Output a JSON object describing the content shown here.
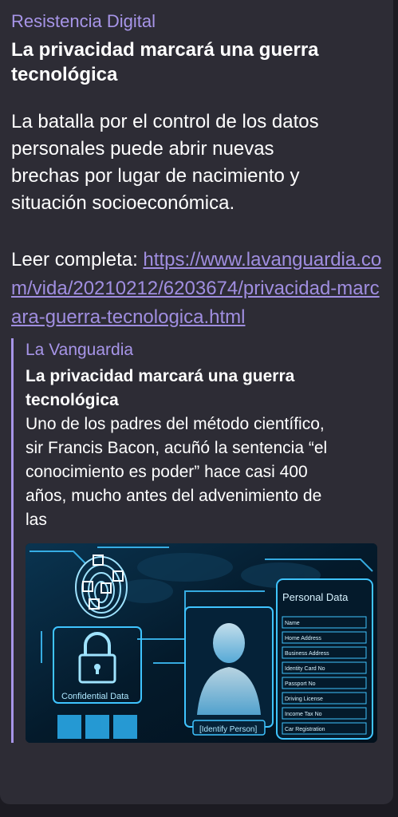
{
  "message": {
    "channel_name": "Resistencia Digital",
    "headline": "La privacidad marcará una guerra\ntecnológica",
    "body": "La batalla por el control de los datos\npersonales puede abrir nuevas\nbrechas por lugar de nacimiento y\nsituación socioeconómica.",
    "read_prefix": "Leer completa: ",
    "link_url": "https://www.lavanguardia.com/vida/20210212/6203674/privacidad-marcara-guerra-tecnologica.html"
  },
  "preview": {
    "site_name": "La Vanguardia",
    "title": "La privacidad marcará una guerra\ntecnológica",
    "description": "Uno de los padres del método científico,\nsir Francis Bacon, acuñó la sentencia “el\nconocimiento es poder” hace casi 400\naños, mucho antes del advenimiento de\nlas",
    "image": {
      "panel_title": "Personal Data",
      "lock_caption": "Confidential Data",
      "person_caption": "[Identify Person]",
      "fields": [
        "Name",
        "Home Address",
        "Business Address",
        "Identity Card No",
        "Passport No",
        "Driving License",
        "Income Tax No",
        "Car Registration"
      ]
    }
  },
  "colors": {
    "bubble": "#2d2c35",
    "accent": "#a795e8",
    "link": "#a08ee0",
    "image_glow": "#3fc4ff"
  }
}
